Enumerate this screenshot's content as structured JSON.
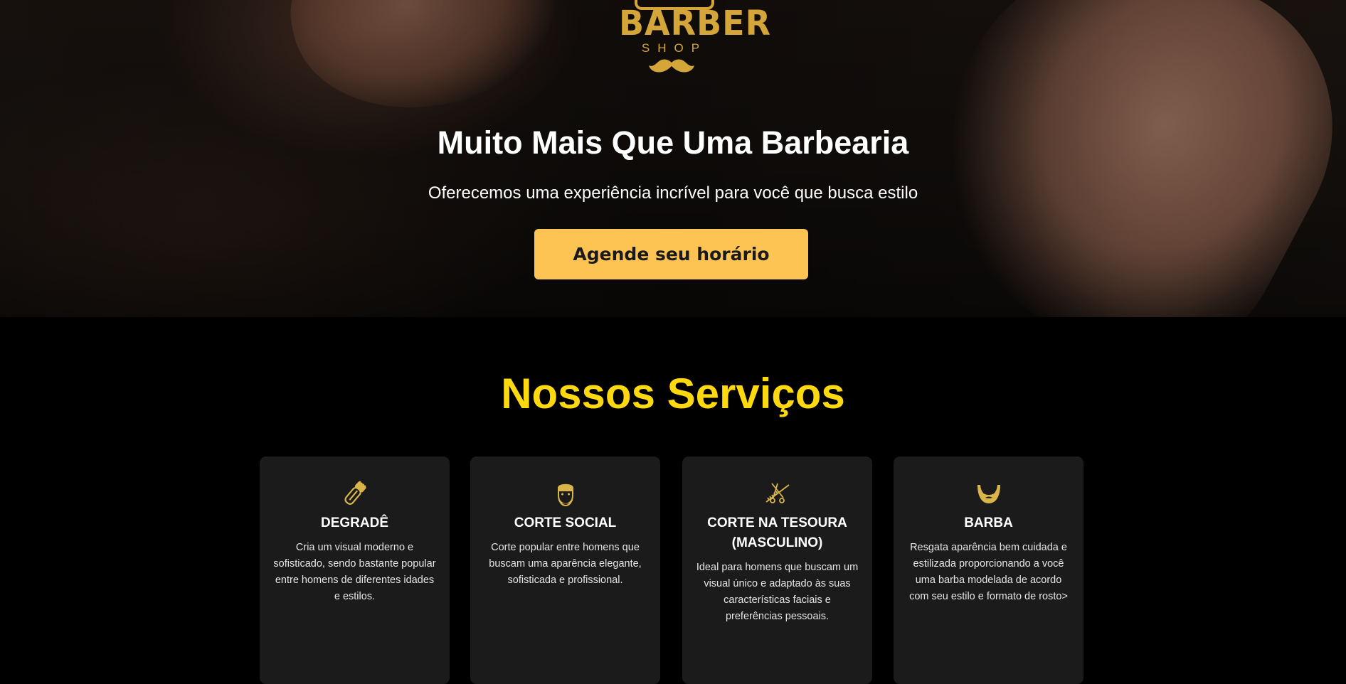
{
  "hero": {
    "logo": {
      "brand": "BARBER",
      "sub": "SHOP"
    },
    "title": "Muito Mais Que Uma Barbearia",
    "subtitle": "Oferecemos uma experiência incrível para você que busca estilo",
    "cta_label": "Agende seu horário"
  },
  "services": {
    "title": "Nossos Serviços",
    "items": [
      {
        "icon": "trimmer-icon",
        "title": "DEGRADÊ",
        "description": "Cria um visual moderno e sofisticado, sendo bastante popular entre homens de diferentes idades e estilos."
      },
      {
        "icon": "bearded-man-icon",
        "title": "CORTE SOCIAL",
        "description": "Corte popular entre homens que buscam uma aparência elegante, sofisticada e profissional."
      },
      {
        "icon": "scissors-comb-icon",
        "title": "CORTE NA TESOURA (MASCULINO)",
        "description": "Ideal para homens que buscam um visual único e adaptado às suas características faciais e preferências pessoais."
      },
      {
        "icon": "beard-icon",
        "title": "BARBA",
        "description": "Resgata aparência bem cuidada e estilizada proporcionando a você uma barba modelada de acordo com seu estilo e formato de rosto>"
      }
    ]
  },
  "colors": {
    "accent_gold": "#fec453",
    "heading_yellow": "#fed90f",
    "icon_gold": "#d9b54a",
    "card_bg": "#1b1b1b",
    "page_bg": "#000000"
  }
}
